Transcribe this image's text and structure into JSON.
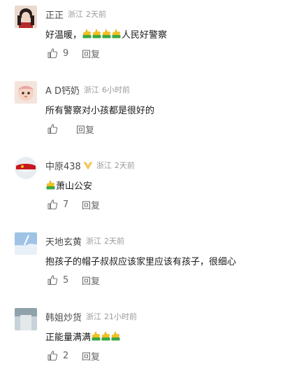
{
  "comments": [
    {
      "username": "正正",
      "location": "浙江",
      "time": "2天前",
      "text_before": "好温暖，",
      "thumbs": 4,
      "text_after": "人民好警察",
      "likes": "9",
      "reply_label": "回复"
    },
    {
      "username": "A D钙奶",
      "location": "浙江",
      "time": "6小时前",
      "text_before": "所有警察对小孩都是很好的",
      "thumbs": 0,
      "text_after": "",
      "likes": "",
      "reply_label": "回复"
    },
    {
      "username": "中原438",
      "location": "浙江",
      "time": "2天前",
      "text_before": "",
      "thumbs": 1,
      "text_after": "萧山公安",
      "likes": "7",
      "reply_label": "回复"
    },
    {
      "username": "天地玄黄",
      "location": "浙江",
      "time": "2天前",
      "text_before": "抱孩子的帽子叔叔应该家里应该有孩子，很细心",
      "thumbs": 0,
      "text_after": "",
      "likes": "5",
      "reply_label": "回复"
    },
    {
      "username": "韩姐炒货",
      "location": "浙江",
      "time": "21小时前",
      "text_before": "正能量满满",
      "thumbs": 3,
      "text_after": "",
      "likes": "2",
      "reply_label": "回复"
    }
  ],
  "icons": {
    "like": "thumbs-up-outline-icon",
    "emoji": "thumbs-up-emoji-icon",
    "badge": "verified-badge-icon"
  },
  "colors": {
    "username": "#4a4a4a",
    "meta": "#9a9a9a",
    "text": "#1a1a1a",
    "action": "#666666",
    "emoji_yellow": "#f5c21b",
    "emoji_green": "#39a845"
  }
}
